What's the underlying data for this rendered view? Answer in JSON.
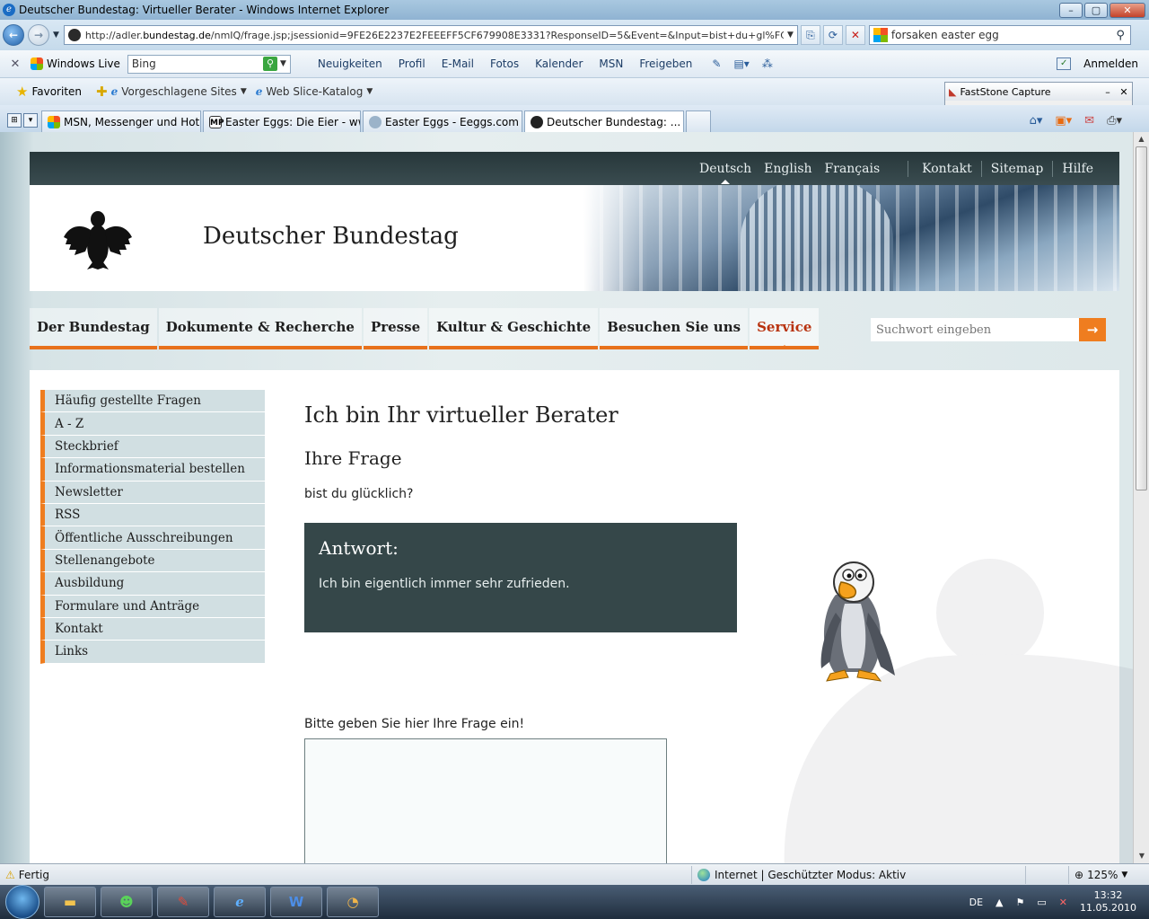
{
  "window": {
    "title": "Deutscher Bundestag: Virtueller Berater - Windows Internet Explorer"
  },
  "address": {
    "url_prefix": "http://adler.",
    "url_domain": "bundestag.de",
    "url_rest": "/nmIQ/frage.jsp;jsessionid=9FE26E2237E2FEEEFF5CF679908E3331?ResponseID=5&Event=&Input=bist+du+gl%FCcklich%"
  },
  "search_box": {
    "value": "forsaken easter egg"
  },
  "livebar": {
    "brand": "Windows Live",
    "bing_value": "Bing",
    "links": [
      "Neuigkeiten",
      "Profil",
      "E-Mail",
      "Fotos",
      "Kalender",
      "MSN",
      "Freigeben"
    ],
    "signin": "Anmelden"
  },
  "favbar": {
    "favorites": "Favoriten",
    "suggested": "Vorgeschlagene Sites",
    "webslice": "Web Slice-Katalog"
  },
  "faststone": {
    "title": "FastStone Capture"
  },
  "tabs": [
    {
      "label": "MSN, Messenger und Hot..."
    },
    {
      "label": "Easter Eggs: Die Eier - ww..."
    },
    {
      "label": "Easter Eggs - Eeggs.com"
    },
    {
      "label": "Deutscher Bundestag: ..."
    }
  ],
  "page": {
    "languages": [
      "Deutsch",
      "English",
      "Français"
    ],
    "service_links": [
      "Kontakt",
      "Sitemap",
      "Hilfe"
    ],
    "brand": "Deutscher Bundestag",
    "mainnav": [
      "Der Bundestag",
      "Dokumente & Recherche",
      "Presse",
      "Kultur & Geschichte",
      "Besuchen Sie uns",
      "Service"
    ],
    "site_search_placeholder": "Suchwort eingeben",
    "sidenav": [
      "Häufig gestellte Fragen",
      "A - Z",
      "Steckbrief",
      "Informationsmaterial bestellen",
      "Newsletter",
      "RSS",
      "Öffentliche Ausschreibungen",
      "Stellenangebote",
      "Ausbildung",
      "Formulare und Anträge",
      "Kontakt",
      "Links"
    ],
    "heading": "Ich bin Ihr virtueller Berater",
    "question_heading": "Ihre Frage",
    "question_text": "bist du glücklich?",
    "answer_heading": "Antwort:",
    "answer_text": "Ich bin eigentlich immer sehr zufrieden.",
    "prompt": "Bitte geben Sie hier Ihre Frage ein!"
  },
  "status": {
    "text": "Fertig",
    "zone": "Internet | Geschützter Modus: Aktiv",
    "zoom": "125%"
  },
  "taskbar": {
    "lang": "DE",
    "time": "13:32",
    "date": "11.05.2010"
  }
}
